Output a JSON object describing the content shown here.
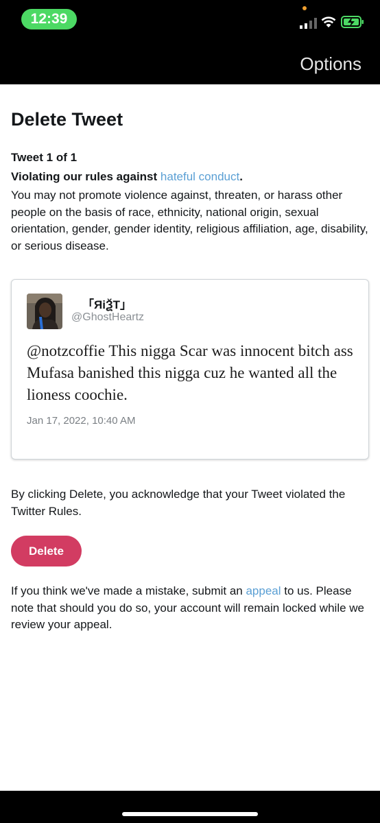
{
  "status_bar": {
    "time": "12:39"
  },
  "nav": {
    "options_label": "Options"
  },
  "page": {
    "title": "Delete Tweet",
    "tweet_count": "Tweet 1 of 1",
    "violating_prefix": "Violating our rules against ",
    "violating_link": "hateful conduct",
    "violating_suffix": ".",
    "rule_text": "You may not promote violence against, threaten, or harass other people on the basis of race, ethnicity, national origin, sexual orientation, gender, gender identity, religious affiliation, age, disability, or serious disease."
  },
  "tweet": {
    "display_name": "「ЯiѮT」",
    "handle": "@GhostHeartz",
    "text": "@notzcoffie This nigga Scar was innocent bitch ass Mufasa banished this nigga cuz he wanted all the lioness coochie.",
    "date": "Jan 17, 2022, 10:40 AM"
  },
  "acknowledge_text": "By clicking Delete, you acknowledge that your Tweet violated the Twitter Rules.",
  "delete_label": "Delete",
  "mistake": {
    "prefix": "If you think we've made a mistake, submit an ",
    "link": "appeal",
    "suffix": " to us. Please note that should you do so, your account will remain locked while we review your appeal."
  },
  "colors": {
    "link": "#5a9fd4",
    "delete_button": "#d23c62",
    "time_pill": "#4cd964"
  }
}
